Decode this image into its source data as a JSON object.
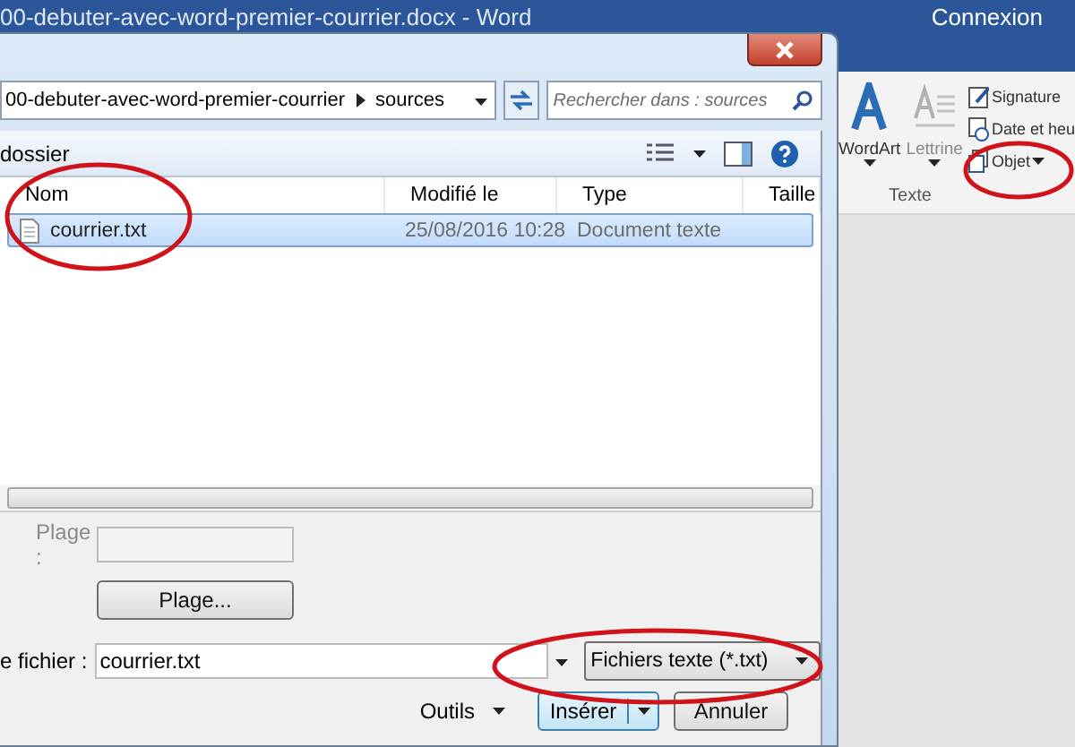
{
  "word_window": {
    "title": "00-debuter-avec-word-premier-courrier.docx - Word",
    "account": "Connexion",
    "ribbon": {
      "large_buttons": [
        {
          "label": "WordArt",
          "disabled": false
        },
        {
          "label": "Lettrine",
          "disabled": true
        }
      ],
      "small_buttons": [
        {
          "label": "Signature",
          "dropdown": false
        },
        {
          "label": "Date et heu",
          "dropdown": false
        },
        {
          "label": "Objet",
          "dropdown": true
        }
      ],
      "group_label": "Texte"
    }
  },
  "dialog": {
    "breadcrumb": [
      "00-debuter-avec-word-premier-courrier",
      "sources"
    ],
    "search": {
      "placeholder": "Rechercher dans : sources"
    },
    "toolbar_label": "dossier",
    "columns": [
      "Nom",
      "Modifié le",
      "Type",
      "Taille"
    ],
    "files": [
      {
        "name": "courrier.txt",
        "modified": "25/08/2016 10:28",
        "type": "Document texte",
        "selected": true
      }
    ],
    "range": {
      "label": "Plage :",
      "button": "Plage...",
      "disabled": true
    },
    "filename": {
      "label": "e fichier :",
      "value": "courrier.txt"
    },
    "filter": "Fichiers texte (*.txt)",
    "tools": "Outils",
    "insert": "Insérer",
    "cancel": "Annuler"
  }
}
